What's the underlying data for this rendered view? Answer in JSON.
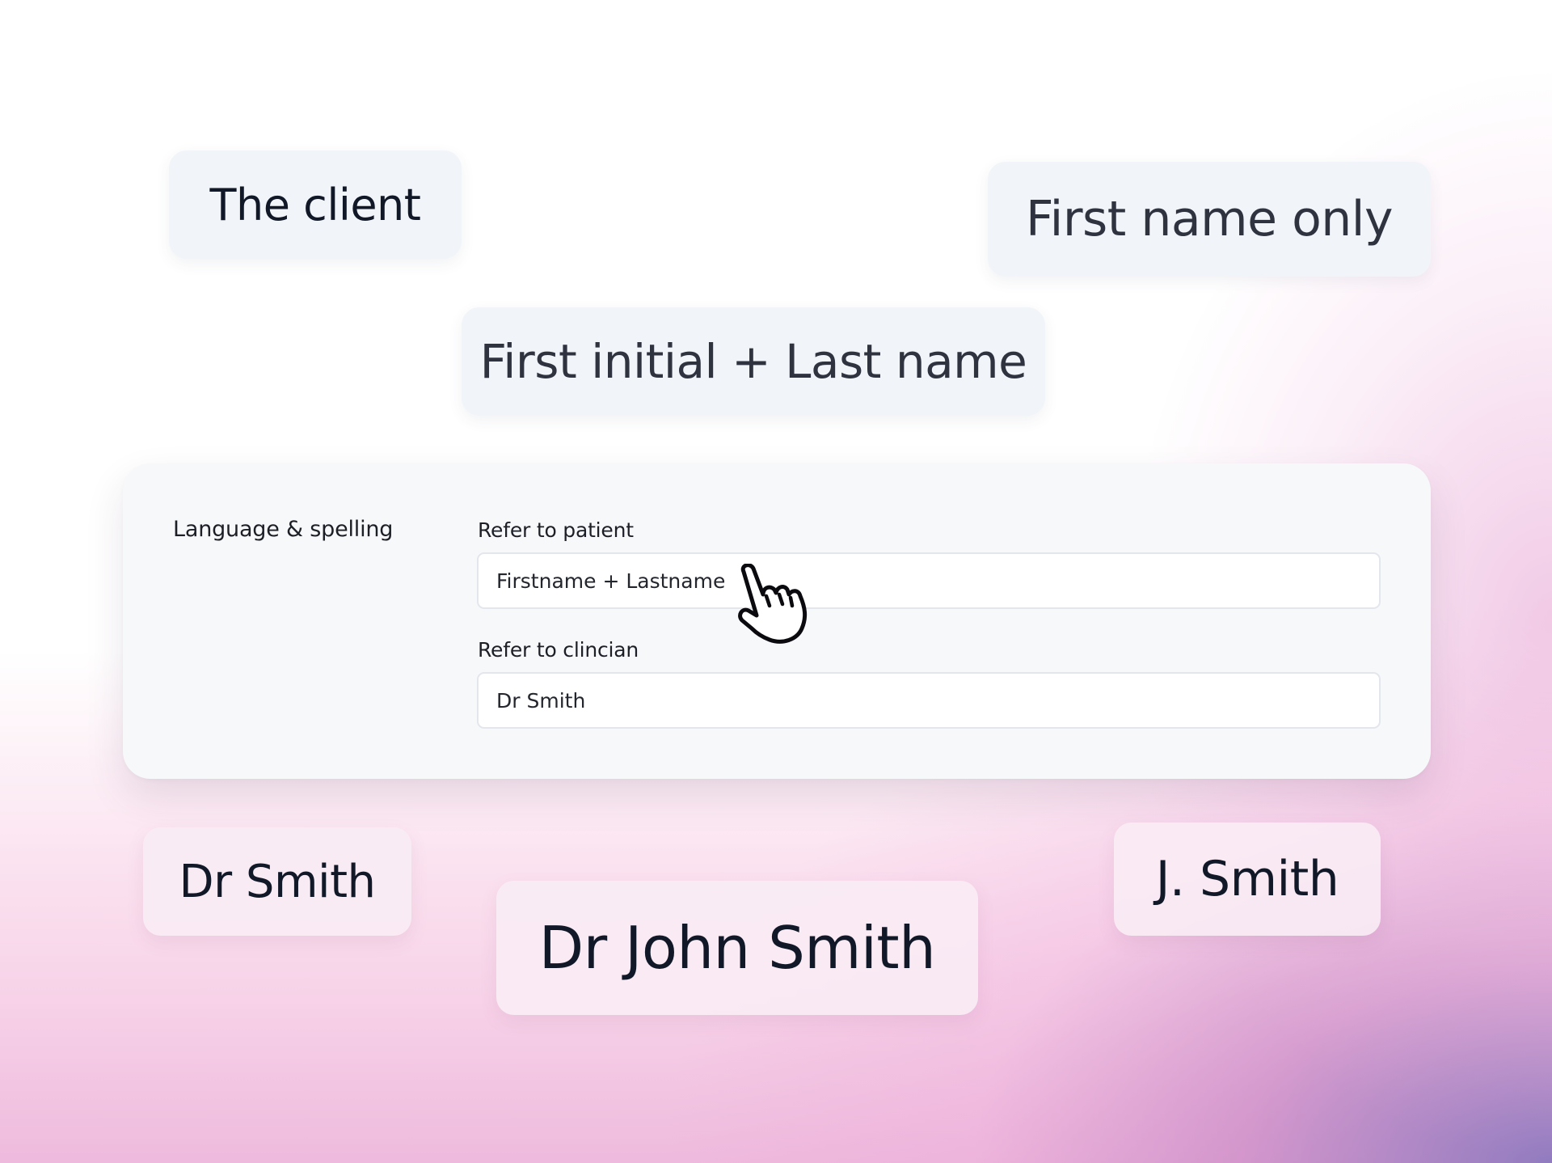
{
  "chips": {
    "the_client": "The client",
    "first_name_only": "First name only",
    "first_initial_last_name": "First initial + Last name",
    "dr_smith": "Dr Smith",
    "dr_john_smith": "Dr John Smith",
    "j_smith": "J. Smith"
  },
  "settings": {
    "section_label": "Language & spelling",
    "refer_to_patient": {
      "label": "Refer to patient",
      "value": "Firstname + Lastname"
    },
    "refer_to_clinician": {
      "label": "Refer to clincian",
      "value": "Dr Smith"
    }
  },
  "cursor": {
    "icon": "pointing-hand-cursor-icon"
  },
  "colors": {
    "chip_background": "#f1f4f8",
    "panel_background": "#f7f8fa",
    "gradient_pink": "#f7d2e8",
    "gradient_purple": "#9b80c0"
  }
}
